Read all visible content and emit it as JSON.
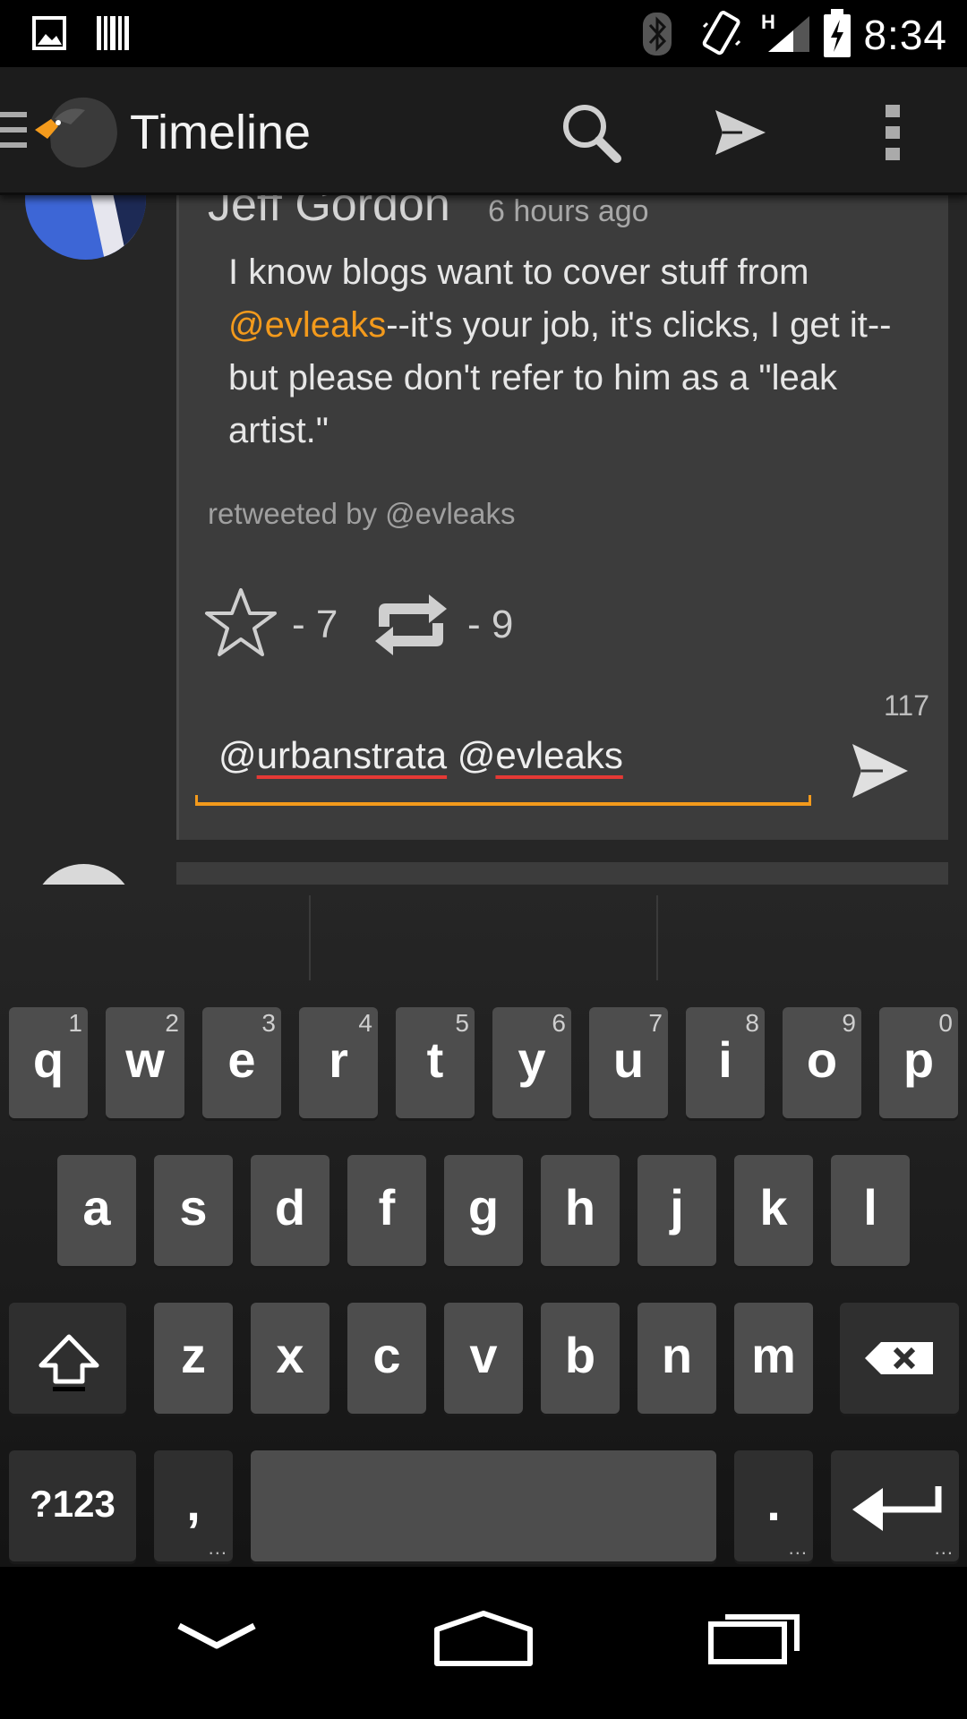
{
  "status_bar": {
    "time": "8:34",
    "network_label": "H",
    "icons": [
      "image-icon",
      "barcode-icon",
      "bluetooth-icon",
      "vibrate-icon",
      "signal-icon",
      "battery-charging-icon"
    ]
  },
  "app_bar": {
    "title": "Timeline",
    "actions": [
      "search-icon",
      "send-icon",
      "overflow-menu-icon"
    ]
  },
  "tweet": {
    "author": "Jeff Gordon",
    "time_ago": "6 hours ago",
    "text_before": "I know blogs want to cover stuff from ",
    "mention": "@evleaks",
    "text_after": "--it's your job, it's clicks, I get it--but please don't refer to him as a \"leak artist.\"",
    "retweeted_by": "retweeted by @evleaks",
    "favorite_count": "- 7",
    "retweet_count": "- 9"
  },
  "reply": {
    "char_count": "117",
    "at1": "@",
    "handle1": "urbanstrata",
    "at2": "@",
    "handle2": "evleaks"
  },
  "keyboard": {
    "row1": [
      {
        "ch": "q",
        "num": "1"
      },
      {
        "ch": "w",
        "num": "2"
      },
      {
        "ch": "e",
        "num": "3"
      },
      {
        "ch": "r",
        "num": "4"
      },
      {
        "ch": "t",
        "num": "5"
      },
      {
        "ch": "y",
        "num": "6"
      },
      {
        "ch": "u",
        "num": "7"
      },
      {
        "ch": "i",
        "num": "8"
      },
      {
        "ch": "o",
        "num": "9"
      },
      {
        "ch": "p",
        "num": "0"
      }
    ],
    "row2": [
      "a",
      "s",
      "d",
      "f",
      "g",
      "h",
      "j",
      "k",
      "l"
    ],
    "row3": [
      "z",
      "x",
      "c",
      "v",
      "b",
      "n",
      "m"
    ],
    "symbols_label": "?123",
    "comma": ",",
    "period": ".",
    "more_dots": "..."
  },
  "colors": {
    "accent": "#f39a1c",
    "spell_underline": "#e53935",
    "card": "#3c3c3c",
    "key": "#4d4d4d"
  }
}
